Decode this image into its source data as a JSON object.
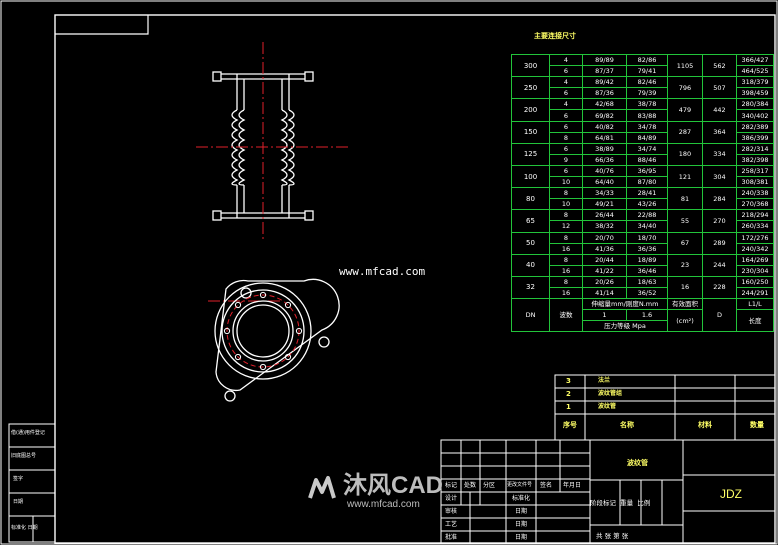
{
  "drawing": {
    "title_label": "主要连接尺寸",
    "website": "www.mfcad.com"
  },
  "table": {
    "rows": [
      {
        "dn": "300",
        "w": [
          "4",
          "6"
        ],
        "p": [
          "89/89",
          "87/37"
        ],
        "q": [
          "82/86",
          "79/41"
        ],
        "area": "1105",
        "d": "562",
        "len": [
          "366/427",
          "464/525"
        ]
      },
      {
        "dn": "250",
        "w": [
          "4",
          "6"
        ],
        "p": [
          "89/42",
          "87/36"
        ],
        "q": [
          "82/46",
          "79/39"
        ],
        "area": "796",
        "d": "507",
        "len": [
          "318/379",
          "398/459"
        ]
      },
      {
        "dn": "200",
        "w": [
          "4",
          "6"
        ],
        "p": [
          "42/68",
          "69/82"
        ],
        "q": [
          "38/78",
          "83/88"
        ],
        "area": "479",
        "d": "442",
        "len": [
          "280/384",
          "340/402"
        ]
      },
      {
        "dn": "150",
        "w": [
          "6",
          "8"
        ],
        "p": [
          "40/82",
          "64/81"
        ],
        "q": [
          "34/78",
          "84/89"
        ],
        "area": "287",
        "d": "364",
        "len": [
          "282/389",
          "386/399"
        ]
      },
      {
        "dn": "125",
        "w": [
          "6",
          "9"
        ],
        "p": [
          "38/89",
          "66/36"
        ],
        "q": [
          "34/74",
          "88/46"
        ],
        "area": "180",
        "d": "334",
        "len": [
          "282/314",
          "382/398"
        ]
      },
      {
        "dn": "100",
        "w": [
          "6",
          "10"
        ],
        "p": [
          "40/76",
          "64/40"
        ],
        "q": [
          "36/95",
          "87/80"
        ],
        "area": "121",
        "d": "304",
        "len": [
          "258/317",
          "308/381"
        ]
      },
      {
        "dn": "80",
        "w": [
          "8",
          "10"
        ],
        "p": [
          "34/33",
          "49/21"
        ],
        "q": [
          "28/41",
          "43/26"
        ],
        "area": "81",
        "d": "284",
        "len": [
          "240/338",
          "270/368"
        ]
      },
      {
        "dn": "65",
        "w": [
          "8",
          "12"
        ],
        "p": [
          "26/44",
          "38/32"
        ],
        "q": [
          "22/88",
          "34/40"
        ],
        "area": "55",
        "d": "270",
        "len": [
          "218/294",
          "260/334"
        ]
      },
      {
        "dn": "50",
        "w": [
          "8",
          "16"
        ],
        "p": [
          "20/70",
          "41/36"
        ],
        "q": [
          "18/70",
          "36/36"
        ],
        "area": "67",
        "d": "289",
        "len": [
          "172/276",
          "240/342"
        ]
      },
      {
        "dn": "40",
        "w": [
          "8",
          "16"
        ],
        "p": [
          "20/44",
          "41/22"
        ],
        "q": [
          "18/89",
          "36/46"
        ],
        "area": "23",
        "d": "244",
        "len": [
          "164/269",
          "230/304"
        ]
      },
      {
        "dn": "32",
        "w": [
          "8",
          "16"
        ],
        "p": [
          "20/26",
          "41/14"
        ],
        "q": [
          "18/63",
          "36/52"
        ],
        "area": "16",
        "d": "228",
        "len": [
          "160/250",
          "244/291"
        ]
      }
    ],
    "footer": {
      "dn": "DN",
      "waves": "波数",
      "stiffness": "伸缩量mm/刚度N.mm",
      "p1": "1",
      "p2": "1.6",
      "pressure": "压力等级 Mpa",
      "area": "有效面积",
      "area_unit": "(cm²)",
      "d": "D",
      "len_top": "L1/L",
      "len_bottom": "长度"
    }
  },
  "parts": {
    "rows": [
      {
        "no": "3",
        "name": "法兰"
      },
      {
        "no": "2",
        "name": "波纹管组"
      },
      {
        "no": "1",
        "name": "波纹管"
      }
    ],
    "header": {
      "no": "序号",
      "name": "名称",
      "material": "材料",
      "qty": "数量"
    }
  },
  "title_block": {
    "drawing_name": "波纹管",
    "code": "JDZ",
    "labels": [
      "标记",
      "处数",
      "分区",
      "更改文件号",
      "签名",
      "年月日"
    ],
    "labels2": [
      "设计",
      "标准化",
      "阶段标记",
      "重量",
      "比例"
    ],
    "rows_left": [
      "审核",
      "工艺",
      "批准"
    ],
    "rows_mid": [
      "日期",
      "日期",
      "日期"
    ],
    "bottom": "共 张 第 张"
  },
  "side_table": {
    "rows": [
      "借(通)用件登记",
      "旧底图总号",
      "签字",
      "日期",
      "标准化 日期"
    ]
  },
  "watermark": {
    "brand": "沐风CAD",
    "site": "www.mfcad.com"
  }
}
